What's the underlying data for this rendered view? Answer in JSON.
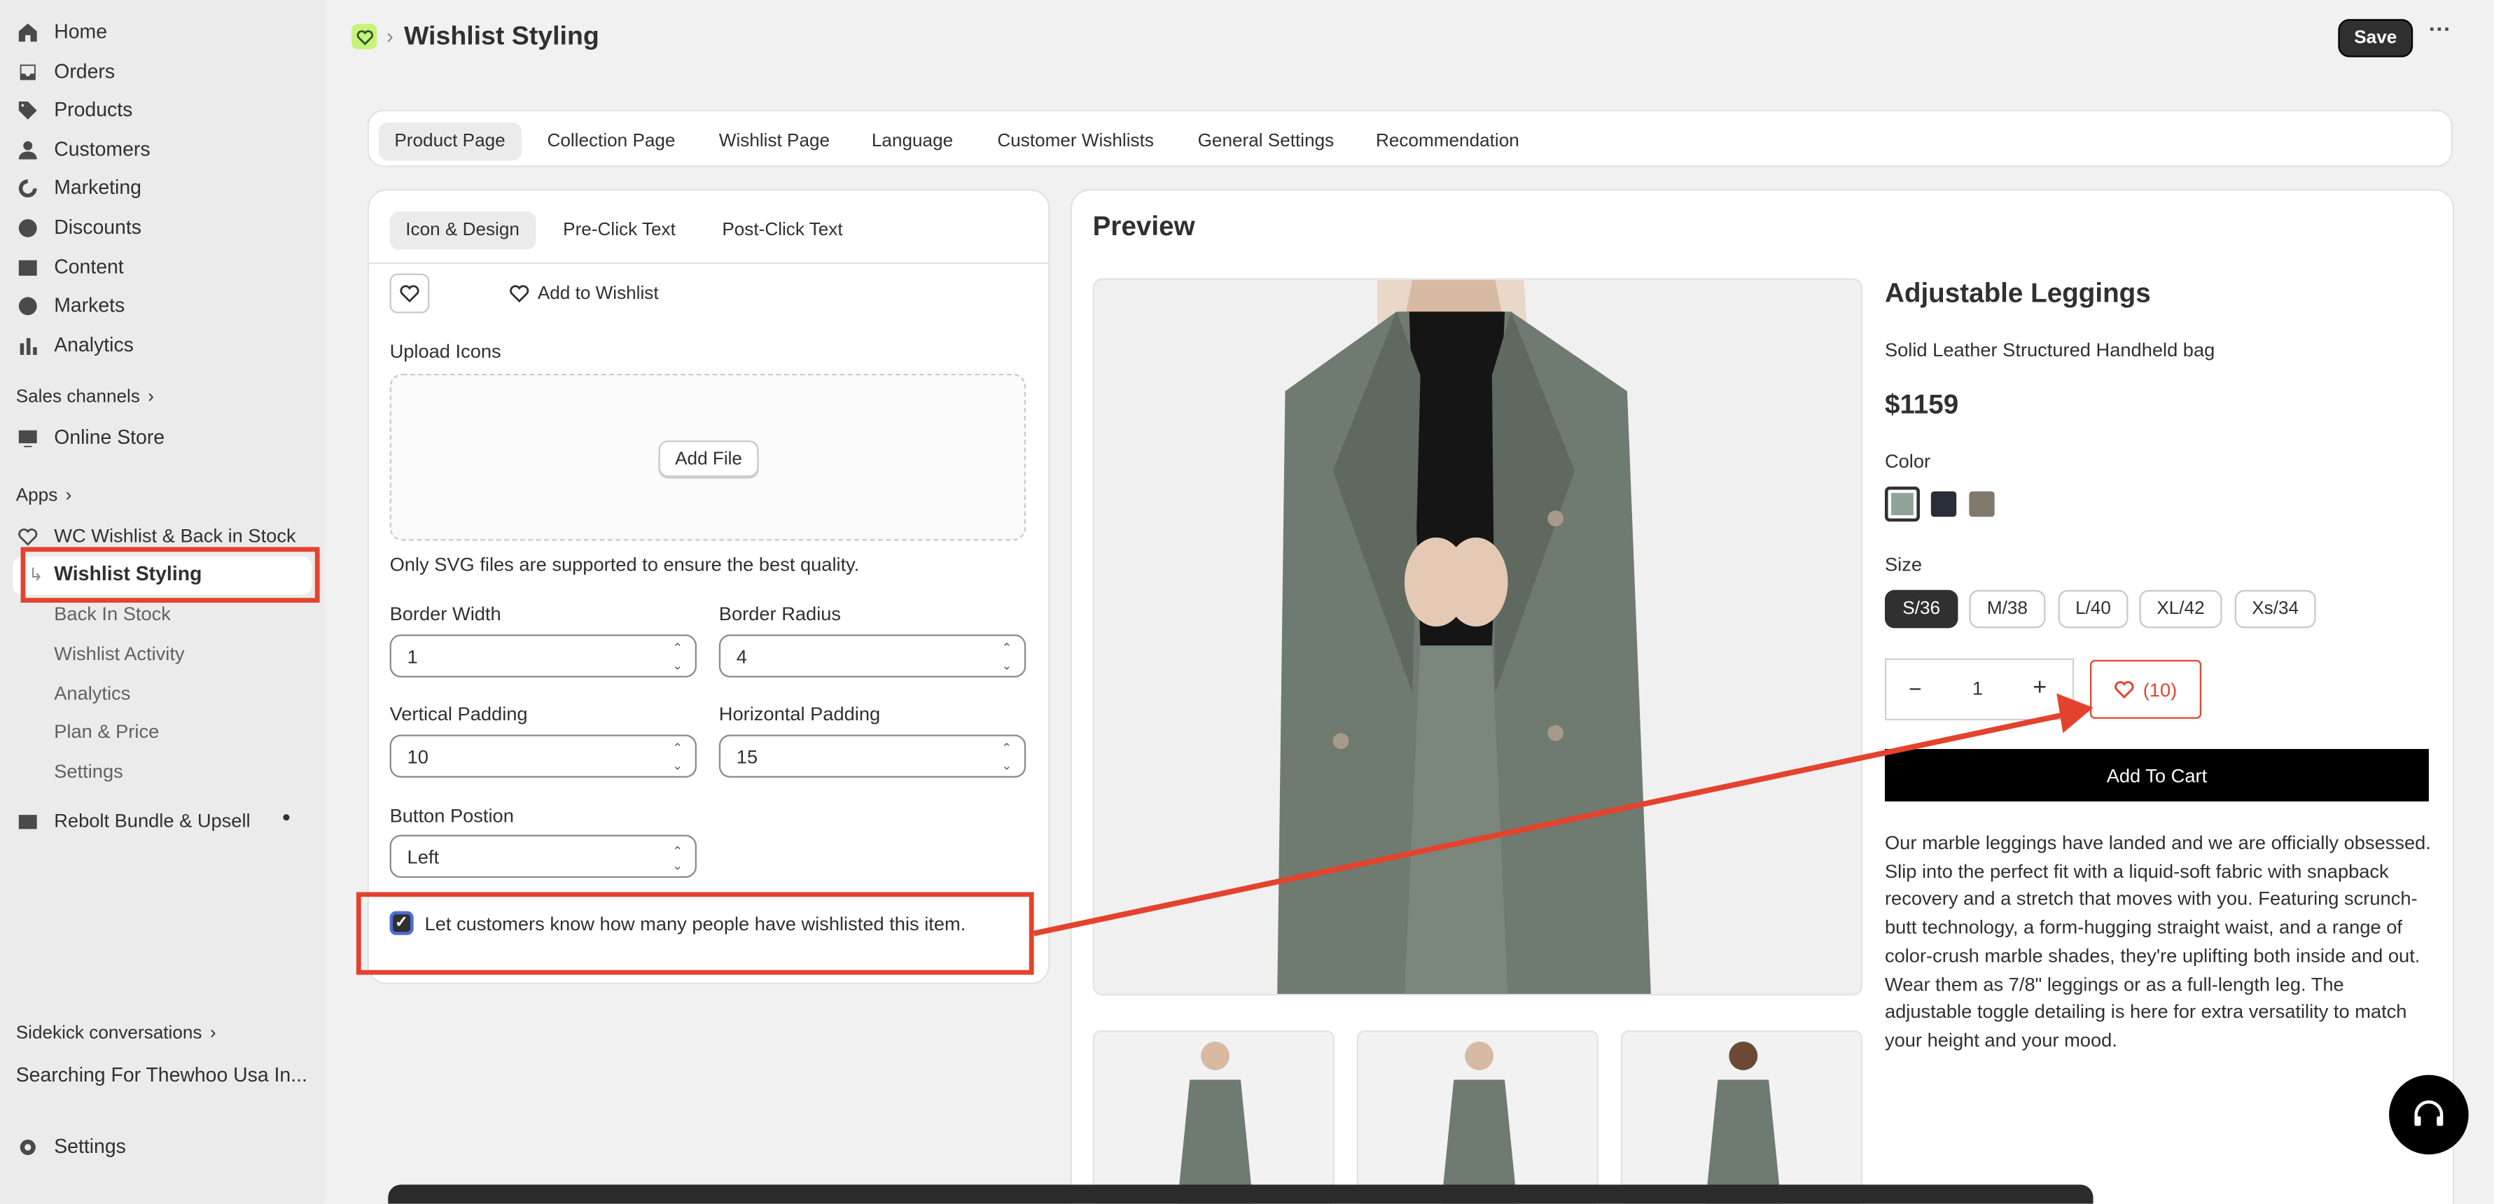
{
  "sidebar": {
    "nav": [
      {
        "label": "Home",
        "icon": "home-icon"
      },
      {
        "label": "Orders",
        "icon": "orders-icon"
      },
      {
        "label": "Products",
        "icon": "tag-icon"
      },
      {
        "label": "Customers",
        "icon": "person-icon"
      },
      {
        "label": "Marketing",
        "icon": "marketing-icon"
      },
      {
        "label": "Discounts",
        "icon": "discount-icon"
      },
      {
        "label": "Content",
        "icon": "content-icon"
      },
      {
        "label": "Markets",
        "icon": "globe-icon"
      },
      {
        "label": "Analytics",
        "icon": "bar-chart-icon"
      }
    ],
    "sales_channels": "Sales channels",
    "online_store": "Online Store",
    "apps": "Apps",
    "app_name": "WC Wishlist & Back in Stock",
    "app_items": [
      "Wishlist Styling",
      "Back In Stock",
      "Wishlist Activity",
      "Analytics",
      "Plan & Price",
      "Settings"
    ],
    "rebolt": "Rebolt Bundle & Upsell",
    "sidekick": "Sidekick conversations",
    "sidekick_recent": "Searching For Thewhoo Usa In...",
    "settings": "Settings"
  },
  "header": {
    "title": "Wishlist Styling",
    "save": "Save",
    "more": "···"
  },
  "tabs": [
    "Product Page",
    "Collection Page",
    "Wishlist Page",
    "Language",
    "Customer Wishlists",
    "General Settings",
    "Recommendation"
  ],
  "settings_card": {
    "subtabs": [
      "Icon & Design",
      "Pre-Click Text",
      "Post-Click Text"
    ],
    "add_to_wishlist": "Add to Wishlist",
    "upload_label": "Upload Icons",
    "add_file": "Add File",
    "svg_note": "Only SVG files are supported to ensure the best quality.",
    "border_width_label": "Border Width",
    "border_width": "1",
    "border_radius_label": "Border Radius",
    "border_radius": "4",
    "vpad_label": "Vertical Padding",
    "vpad": "10",
    "hpad_label": "Horizontal Padding",
    "hpad": "15",
    "position_label": "Button Postion",
    "position": "Left",
    "checkbox_label": "Let customers know how many people have wishlisted this item.",
    "checkbox_checked": true
  },
  "preview": {
    "title": "Preview",
    "product_name": "Adjustable Leggings",
    "subtitle": "Solid Leather Structured Handheld bag",
    "price": "$1159",
    "color_label": "Color",
    "colors": [
      "#8fa399",
      "#2a2d3a",
      "#7f7a6c"
    ],
    "size_label": "Size",
    "sizes": [
      "S/36",
      "M/38",
      "L/40",
      "XL/42",
      "Xs/34"
    ],
    "qty": "1",
    "qty_minus": "−",
    "qty_plus": "+",
    "wishlist_count": "(10)",
    "add_to_cart": "Add To Cart",
    "description": "Our marble leggings have landed and we are officially obsessed. Slip into the perfect fit with a liquid-soft fabric with snapback recovery and a stretch that moves with you. Featuring scrunch-butt technology, a form-hugging straight waist, and a range of color-crush marble shades, they're uplifting both inside and out. Wear them as 7/8\" leggings or as a full-length leg. The adjustable toggle detailing is here for extra versatility to match your height and your mood."
  },
  "colors": {
    "accent": "#e3432e",
    "primary": "#303030",
    "cart": "#000000",
    "jacket": "#6f7a70"
  }
}
